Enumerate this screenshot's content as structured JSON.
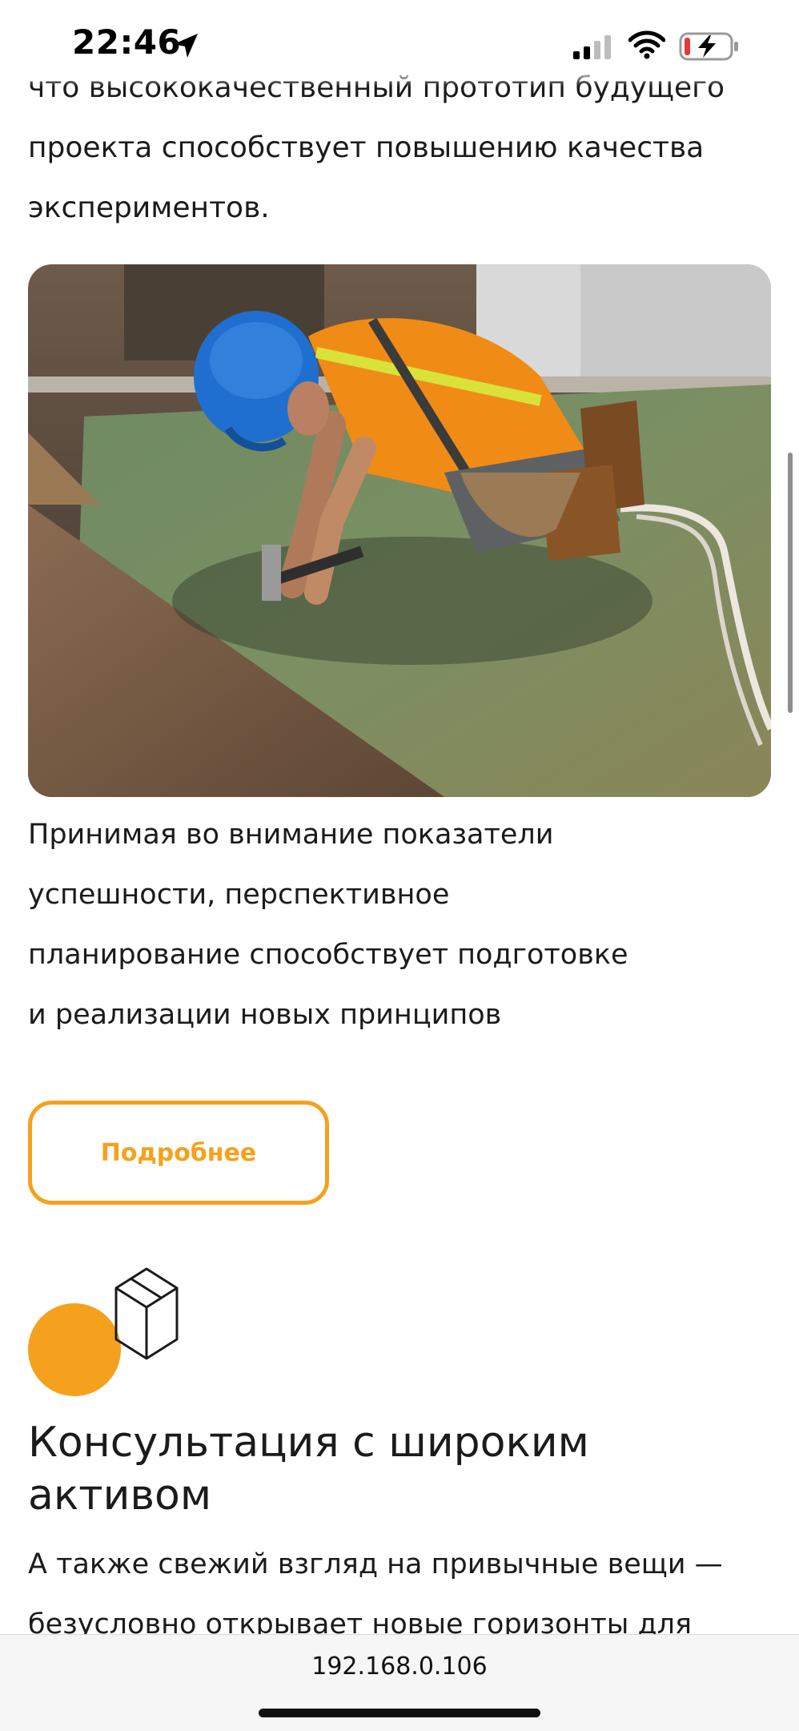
{
  "status_bar": {
    "time": "22:46",
    "accent_battery": "#E53935"
  },
  "content": {
    "intro_lines": [
      "что высококачественный прототип будущего",
      "проекта способствует повышению качества",
      "экспериментов."
    ],
    "hero_image_alt": "Рабочий в синей каске забивает гвоздь на кровле",
    "paragraph_lines": [
      "Принимая во внимание показатели",
      "успешности, перспективное",
      "планирование способствует подготовке",
      "и реализации новых принципов"
    ],
    "more_button_label": "Подробнее",
    "feature": {
      "icon": "box-icon",
      "title": "Консультация с широким активом",
      "text_lines": [
        "А также свежий взгляд на привычные вещи —",
        "безусловно открывает новые горизонты для"
      ]
    }
  },
  "browser": {
    "address": "192.168.0.106"
  },
  "colors": {
    "accent": "#F5A11D",
    "text": "#1B1B1B"
  }
}
